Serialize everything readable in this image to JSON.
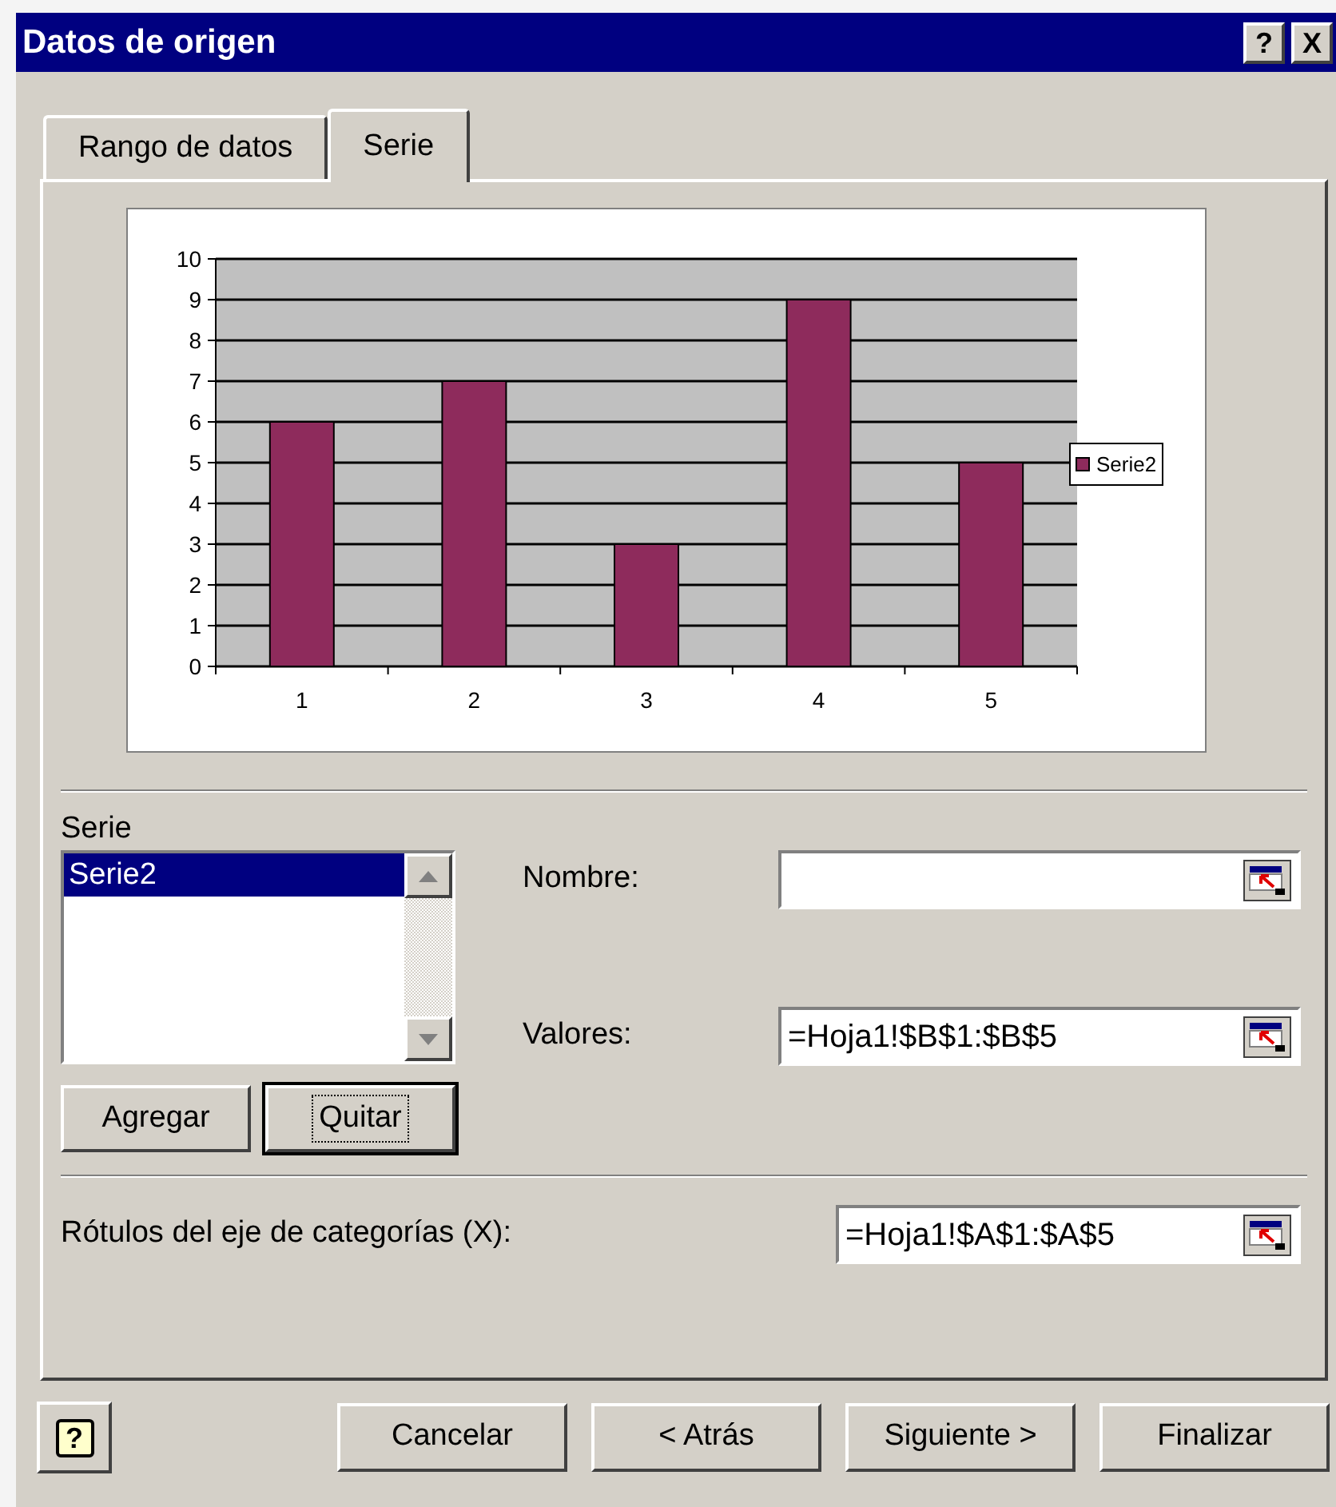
{
  "window": {
    "title": "Datos de origen",
    "buttons": [
      {
        "kind": "help",
        "label": "?"
      },
      {
        "kind": "close",
        "label": "X"
      }
    ]
  },
  "tabs": [
    {
      "label": "Rango de datos",
      "selected": false
    },
    {
      "label": "Serie",
      "selected": true
    }
  ],
  "chart": {
    "chart_data": {
      "type": "bar",
      "grid": true,
      "categories": [
        "1",
        "2",
        "3",
        "4",
        "5"
      ],
      "series": [
        {
          "name": "Serie2",
          "color": "#8e2b5c",
          "values": [
            6,
            7,
            3,
            9,
            5
          ]
        }
      ],
      "ylim": [
        0,
        10
      ],
      "yticks": [
        0,
        1,
        2,
        3,
        4,
        5,
        6,
        7,
        8,
        9,
        10
      ]
    }
  },
  "series_list": {
    "label": "Serie",
    "items": [
      {
        "label": "Serie2",
        "selected": true
      }
    ]
  },
  "fields": [
    {
      "label": "Nombre:"
    },
    {
      "label": "Valores:",
      "value": "=Hoja1!$B$1:$B$5"
    }
  ],
  "list_buttons": [
    {
      "label": "Agregar",
      "focused": false
    },
    {
      "label": "Quitar",
      "focused": true
    }
  ],
  "category_field": {
    "label": "Rótulos del eje de categorías (X):",
    "value": "=Hoja1!$A$1:$A$5"
  },
  "help_button": {
    "label": "?"
  },
  "footer_buttons": [
    {
      "label": "Cancelar"
    },
    {
      "label": "< Atrás"
    },
    {
      "label": "Siguiente >"
    },
    {
      "label": "Finalizar"
    }
  ]
}
